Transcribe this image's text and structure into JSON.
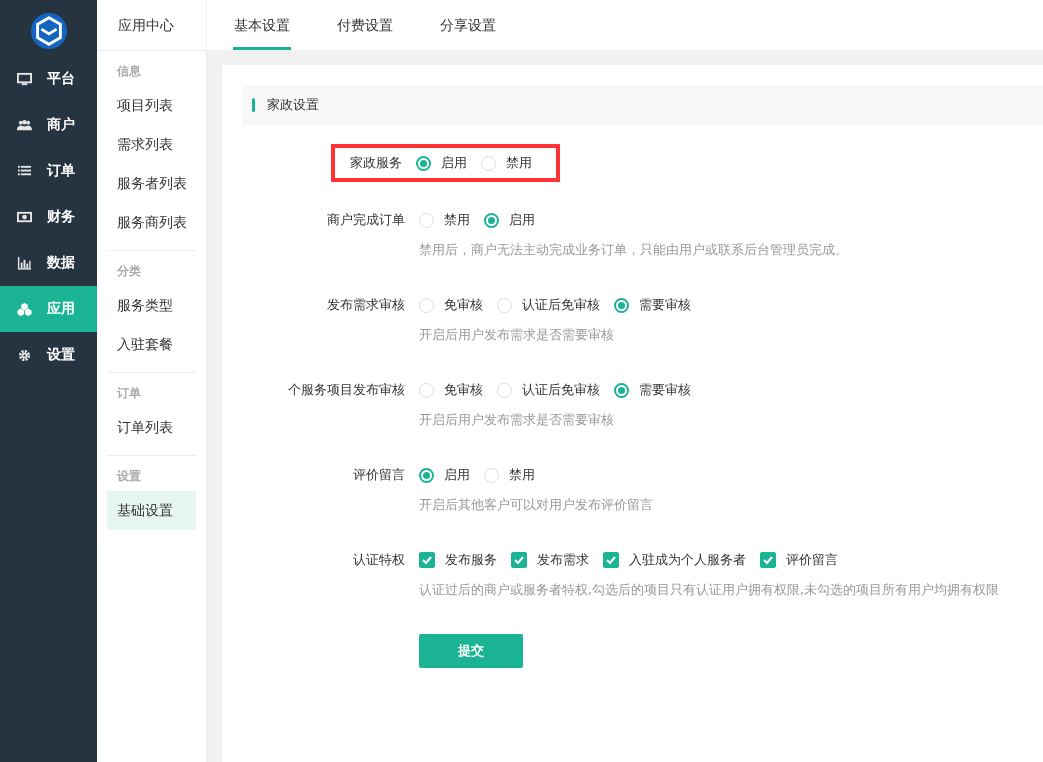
{
  "sidebar": {
    "items": [
      {
        "label": "平台",
        "selected": false
      },
      {
        "label": "商户",
        "selected": false
      },
      {
        "label": "订单",
        "selected": false
      },
      {
        "label": "财务",
        "selected": false
      },
      {
        "label": "数据",
        "selected": false
      },
      {
        "label": "应用",
        "selected": true
      },
      {
        "label": "设置",
        "selected": false
      }
    ]
  },
  "subnav": {
    "title": "应用中心",
    "groups": [
      {
        "heading": "信息",
        "items": [
          {
            "label": "项目列表",
            "selected": false
          },
          {
            "label": "需求列表",
            "selected": false
          },
          {
            "label": "服务者列表",
            "selected": false
          },
          {
            "label": "服务商列表",
            "selected": false
          }
        ]
      },
      {
        "heading": "分类",
        "items": [
          {
            "label": "服务类型",
            "selected": false
          },
          {
            "label": "入驻套餐",
            "selected": false
          }
        ]
      },
      {
        "heading": "订单",
        "items": [
          {
            "label": "订单列表",
            "selected": false
          }
        ]
      },
      {
        "heading": "设置",
        "items": [
          {
            "label": "基础设置",
            "selected": true
          }
        ]
      }
    ]
  },
  "tabs": [
    {
      "label": "基本设置",
      "selected": true
    },
    {
      "label": "付费设置",
      "selected": false
    },
    {
      "label": "分享设置",
      "selected": false
    }
  ],
  "section_title": "家政设置",
  "fields": [
    {
      "label": "家政服务",
      "kind": "radio",
      "highlighted": true,
      "options": [
        {
          "label": "启用",
          "selected": true
        },
        {
          "label": "禁用",
          "selected": false
        }
      ]
    },
    {
      "label": "商户完成订单",
      "kind": "radio",
      "highlighted": false,
      "options": [
        {
          "label": "禁用",
          "selected": false
        },
        {
          "label": "启用",
          "selected": true
        }
      ],
      "hint": "禁用后，商户无法主动完成业务订单，只能由用户或联系后台管理员完成。"
    },
    {
      "label": "发布需求审核",
      "kind": "radio",
      "highlighted": false,
      "options": [
        {
          "label": "免审核",
          "selected": false
        },
        {
          "label": "认证后免审核",
          "selected": false
        },
        {
          "label": "需要审核",
          "selected": true
        }
      ],
      "hint": "开启后用户发布需求是否需要审核"
    },
    {
      "label": "个服务项目发布审核",
      "kind": "radio",
      "highlighted": false,
      "options": [
        {
          "label": "免审核",
          "selected": false
        },
        {
          "label": "认证后免审核",
          "selected": false
        },
        {
          "label": "需要审核",
          "selected": true
        }
      ],
      "hint": "开启后用户发布需求是否需要审核"
    },
    {
      "label": "评价留言",
      "kind": "radio",
      "highlighted": false,
      "options": [
        {
          "label": "启用",
          "selected": true
        },
        {
          "label": "禁用",
          "selected": false
        }
      ],
      "hint": "开启后其他客户可以对用户发布评价留言"
    },
    {
      "label": "认证特权",
      "kind": "checkbox",
      "highlighted": false,
      "options": [
        {
          "label": "发布服务",
          "checked": true
        },
        {
          "label": "发布需求",
          "checked": true
        },
        {
          "label": "入驻成为个人服务者",
          "checked": true
        },
        {
          "label": "评价留言",
          "checked": true
        }
      ],
      "hint": "认证过后的商户或服务者特权,勾选后的项目只有认证用户拥有权限,未勾选的项目所有用户均拥有权限"
    }
  ],
  "submit_button": "提交"
}
